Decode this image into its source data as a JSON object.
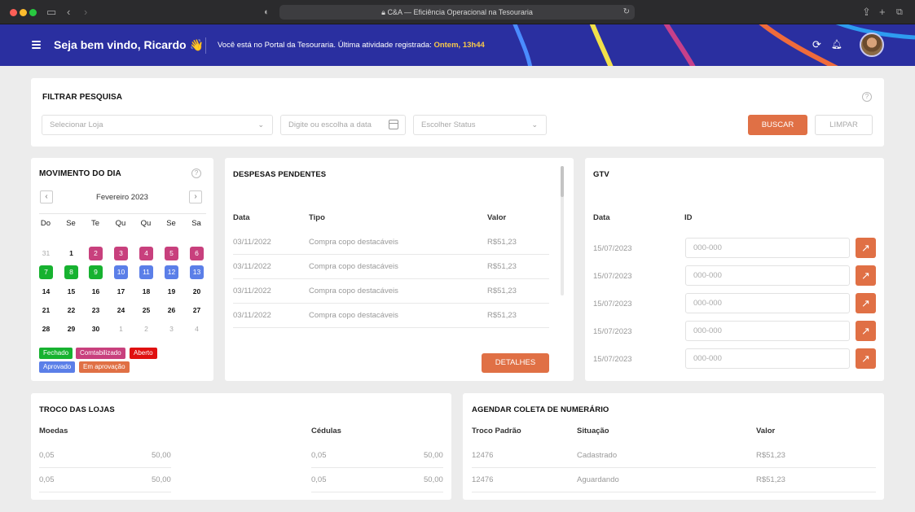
{
  "browser": {
    "url_title": "C&A — Eficiência Operacional na Tesouraria"
  },
  "header": {
    "greeting": "Seja bem vindo, Ricardo",
    "wave_emoji": "👋",
    "portal_text": "Você está no Portal da Tesouraria. Última atividade registrada:",
    "last_activity": "Ontem, 13h44"
  },
  "filter": {
    "title": "FILTRAR PESQUISA",
    "store_placeholder": "Selecionar Loja",
    "date_placeholder": "Digite ou escolha a data",
    "status_placeholder": "Escolher Status",
    "search_label": "BUSCAR",
    "clear_label": "LIMPAR"
  },
  "calendar": {
    "title": "MOVIMENTO DO DIA",
    "month": "Fevereiro 2023",
    "weekdays": [
      "Do",
      "Se",
      "Te",
      "Qu",
      "Qu",
      "Se",
      "Sa"
    ],
    "weeks": [
      [
        {
          "d": "31",
          "s": "muted"
        },
        {
          "d": "1",
          "s": ""
        },
        {
          "d": "2",
          "s": "contab"
        },
        {
          "d": "3",
          "s": "contab"
        },
        {
          "d": "4",
          "s": "contab"
        },
        {
          "d": "5",
          "s": "contab"
        },
        {
          "d": "6",
          "s": "contab"
        }
      ],
      [
        {
          "d": "7",
          "s": "fechado"
        },
        {
          "d": "8",
          "s": "fechado"
        },
        {
          "d": "9",
          "s": "fechado"
        },
        {
          "d": "10",
          "s": "aprovado"
        },
        {
          "d": "11",
          "s": "aprovado"
        },
        {
          "d": "12",
          "s": "aprovado"
        },
        {
          "d": "13",
          "s": "aprovado"
        }
      ],
      [
        {
          "d": "14",
          "s": ""
        },
        {
          "d": "15",
          "s": ""
        },
        {
          "d": "16",
          "s": ""
        },
        {
          "d": "17",
          "s": ""
        },
        {
          "d": "18",
          "s": ""
        },
        {
          "d": "19",
          "s": ""
        },
        {
          "d": "20",
          "s": ""
        }
      ],
      [
        {
          "d": "21",
          "s": ""
        },
        {
          "d": "22",
          "s": ""
        },
        {
          "d": "23",
          "s": ""
        },
        {
          "d": "24",
          "s": ""
        },
        {
          "d": "25",
          "s": ""
        },
        {
          "d": "26",
          "s": ""
        },
        {
          "d": "27",
          "s": ""
        }
      ],
      [
        {
          "d": "28",
          "s": ""
        },
        {
          "d": "29",
          "s": ""
        },
        {
          "d": "30",
          "s": ""
        },
        {
          "d": "1",
          "s": "muted"
        },
        {
          "d": "2",
          "s": "muted"
        },
        {
          "d": "3",
          "s": "muted"
        },
        {
          "d": "4",
          "s": "muted"
        }
      ]
    ],
    "legend": [
      {
        "label": "Fechado",
        "color": "#17b230"
      },
      {
        "label": "Comtabilizado",
        "color": "#c8407d"
      },
      {
        "label": "Aberto",
        "color": "#e01010"
      },
      {
        "label": "Aprovado",
        "color": "#5b7fe8"
      },
      {
        "label": "Em aprovação",
        "color": "#e07045"
      }
    ],
    "status_colors": {
      "fechado": "#17b230",
      "contab": "#c8407d",
      "aprovado": "#5b7fe8"
    }
  },
  "despesas": {
    "title": "DESPESAS PENDENTES",
    "headers": [
      "Data",
      "Tipo",
      "Valor"
    ],
    "rows": [
      [
        "03/11/2022",
        "Compra copo destacáveis",
        "R$51,23"
      ],
      [
        "03/11/2022",
        "Compra copo destacáveis",
        "R$51,23"
      ],
      [
        "03/11/2022",
        "Compra copo destacáveis",
        "R$51,23"
      ],
      [
        "03/11/2022",
        "Compra copo destacáveis",
        "R$51,23"
      ]
    ],
    "details_label": "DETALHES"
  },
  "gtv": {
    "title": "GTV",
    "headers": [
      "Data",
      "ID"
    ],
    "rows": [
      {
        "date": "15/07/2023",
        "placeholder": "000-000"
      },
      {
        "date": "15/07/2023",
        "placeholder": "000-000"
      },
      {
        "date": "15/07/2023",
        "placeholder": "000-000"
      },
      {
        "date": "15/07/2023",
        "placeholder": "000-000"
      },
      {
        "date": "15/07/2023",
        "placeholder": "000-000"
      }
    ]
  },
  "troco": {
    "title": "TROCO DAS LOJAS",
    "moedas_label": "Moedas",
    "cedulas_label": "Cédulas",
    "moedas_rows": [
      [
        "0,05",
        "50,00"
      ],
      [
        "0,05",
        "50,00"
      ]
    ],
    "cedulas_rows": [
      [
        "0,05",
        "50,00"
      ],
      [
        "0,05",
        "50,00"
      ]
    ]
  },
  "coleta": {
    "title": "AGENDAR COLETA DE NUMERÁRIO",
    "headers": [
      "Troco Padrão",
      "Situação",
      "Valor"
    ],
    "rows": [
      [
        "12476",
        "Cadastrado",
        "R$51,23"
      ],
      [
        "12476",
        "Aguardando",
        "R$51,23"
      ]
    ]
  },
  "colors": {
    "brand_blue": "#2a2fa0",
    "accent_orange": "#e07045",
    "highlight_yellow": "#f8c94a"
  }
}
